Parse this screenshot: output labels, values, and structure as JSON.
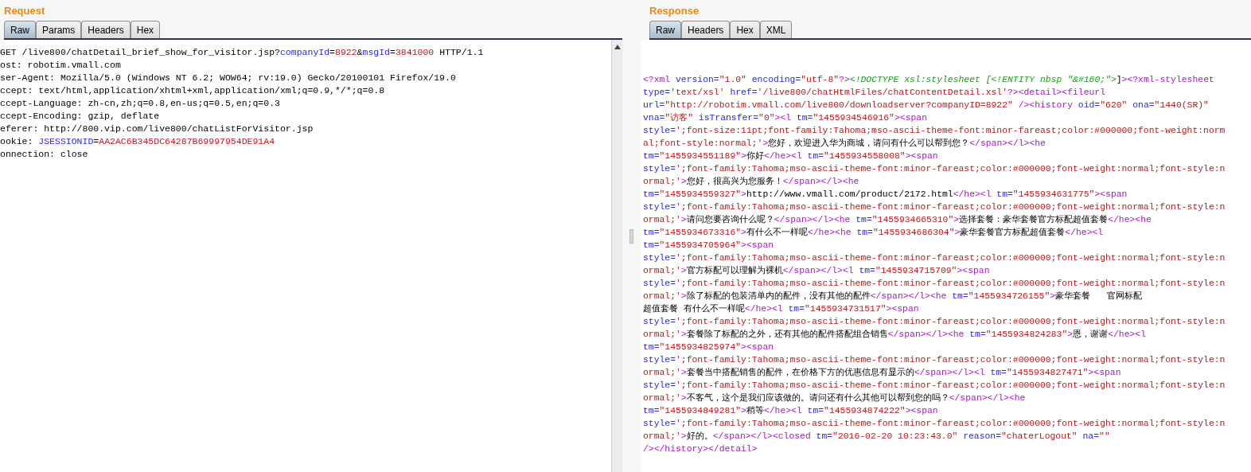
{
  "request": {
    "title": "Request",
    "tabs": [
      {
        "label": "Raw",
        "selected": true
      },
      {
        "label": "Params",
        "selected": false
      },
      {
        "label": "Headers",
        "selected": false
      },
      {
        "label": "Hex",
        "selected": false
      }
    ],
    "lines": [
      [
        {
          "kind": "plain",
          "text": "GET /live800/chatDetail_brief_show_for_visitor.jsp?"
        },
        {
          "kind": "attr",
          "text": "companyId"
        },
        {
          "kind": "plain",
          "text": "="
        },
        {
          "kind": "val",
          "text": "8922"
        },
        {
          "kind": "plain",
          "text": "&"
        },
        {
          "kind": "attr",
          "text": "msgId"
        },
        {
          "kind": "plain",
          "text": "="
        },
        {
          "kind": "val",
          "text": "3841000"
        },
        {
          "kind": "plain",
          "text": " HTTP/1.1"
        }
      ],
      [
        {
          "kind": "plain",
          "text": "ost: robotim.vmall.com"
        }
      ],
      [
        {
          "kind": "plain",
          "text": "ser-Agent: Mozilla/5.0 (Windows NT 6.2; WOW64; rv:19.0) Gecko/20100101 Firefox/19.0"
        }
      ],
      [
        {
          "kind": "plain",
          "text": "ccept: text/html,application/xhtml+xml,application/xml;q=0.9,*/*;q=0.8"
        }
      ],
      [
        {
          "kind": "plain",
          "text": "ccept-Language: zh-cn,zh;q=0.8,en-us;q=0.5,en;q=0.3"
        }
      ],
      [
        {
          "kind": "plain",
          "text": "ccept-Encoding: gzip, deflate"
        }
      ],
      [
        {
          "kind": "plain",
          "text": "eferer: http://800.vip.com/live800/chatListForVisitor.jsp"
        }
      ],
      [
        {
          "kind": "plain",
          "text": "ookie: "
        },
        {
          "kind": "attr",
          "text": "JSESSIONID"
        },
        {
          "kind": "plain",
          "text": "="
        },
        {
          "kind": "val",
          "text": "AA2AC6B345DC64287B69997954DE91A4"
        }
      ],
      [
        {
          "kind": "plain",
          "text": "onnection: close"
        }
      ]
    ]
  },
  "response": {
    "title": "Response",
    "tabs": [
      {
        "label": "Raw",
        "selected": true
      },
      {
        "label": "Headers",
        "selected": false
      },
      {
        "label": "Hex",
        "selected": false
      },
      {
        "label": "XML",
        "selected": false
      }
    ],
    "lines": [
      [
        {
          "kind": "tag",
          "text": "<?xml"
        },
        {
          "kind": "attr",
          "text": " version="
        },
        {
          "kind": "val",
          "text": "\"1.0\""
        },
        {
          "kind": "attr",
          "text": " encoding="
        },
        {
          "kind": "val",
          "text": "\"utf-8\""
        },
        {
          "kind": "tag",
          "text": "?>"
        },
        {
          "kind": "dtd",
          "text": "<!DOCTYPE xsl:stylesheet [<!ENTITY nbsp \"&#160;\">"
        },
        {
          "kind": "plain",
          "text": "]"
        },
        {
          "kind": "tag",
          "text": "><?xml-stylesheet"
        }
      ],
      [
        {
          "kind": "attr",
          "text": "type="
        },
        {
          "kind": "val",
          "text": "'text/xsl'"
        },
        {
          "kind": "attr",
          "text": " href="
        },
        {
          "kind": "val",
          "text": "'/live800/chatHtmlFiles/chatContentDetail.xsl'"
        },
        {
          "kind": "tag",
          "text": "?><detail><fileurl"
        }
      ],
      [
        {
          "kind": "attr",
          "text": "url="
        },
        {
          "kind": "val",
          "text": "\"http://robotim.vmall.com/live800/downloadserver?companyID=8922\""
        },
        {
          "kind": "tag",
          "text": " /><history"
        },
        {
          "kind": "attr",
          "text": " oid="
        },
        {
          "kind": "val",
          "text": "\"620\""
        },
        {
          "kind": "attr",
          "text": " ona="
        },
        {
          "kind": "val",
          "text": "\"1440(SR)\""
        }
      ],
      [
        {
          "kind": "attr",
          "text": "vna="
        },
        {
          "kind": "val",
          "text": "\"访客\""
        },
        {
          "kind": "attr",
          "text": " isTransfer="
        },
        {
          "kind": "val",
          "text": "\"0\""
        },
        {
          "kind": "tag",
          "text": "><l"
        },
        {
          "kind": "attr",
          "text": " tm="
        },
        {
          "kind": "val",
          "text": "\"1455934546916\""
        },
        {
          "kind": "tag",
          "text": "><span"
        }
      ],
      [
        {
          "kind": "attr",
          "text": "style="
        },
        {
          "kind": "val",
          "text": "';font-size:11pt;font-family:Tahoma;mso-ascii-theme-font:minor-fareast;color:#000000;font-weight:norm"
        }
      ],
      [
        {
          "kind": "val",
          "text": "al;font-style:normal;'"
        },
        {
          "kind": "tag",
          "text": ">"
        },
        {
          "kind": "text",
          "text": "您好，欢迎进入华为商城，请问有什么可以帮到您？"
        },
        {
          "kind": "tag",
          "text": "</span></l><he"
        }
      ],
      [
        {
          "kind": "attr",
          "text": "tm="
        },
        {
          "kind": "val",
          "text": "\"1455934551189\""
        },
        {
          "kind": "tag",
          "text": ">"
        },
        {
          "kind": "text",
          "text": "你好"
        },
        {
          "kind": "tag",
          "text": "</he><l"
        },
        {
          "kind": "attr",
          "text": " tm="
        },
        {
          "kind": "val",
          "text": "\"1455934558008\""
        },
        {
          "kind": "tag",
          "text": "><span"
        }
      ],
      [
        {
          "kind": "attr",
          "text": "style="
        },
        {
          "kind": "val",
          "text": "';font-family:Tahoma;mso-ascii-theme-font:minor-fareast;color:#000000;font-weight:normal;font-style:n"
        }
      ],
      [
        {
          "kind": "val",
          "text": "ormal;'"
        },
        {
          "kind": "tag",
          "text": ">"
        },
        {
          "kind": "text",
          "text": "您好，很高兴为您服务！"
        },
        {
          "kind": "tag",
          "text": "</span></l><he"
        }
      ],
      [
        {
          "kind": "attr",
          "text": "tm="
        },
        {
          "kind": "val",
          "text": "\"1455934559327\""
        },
        {
          "kind": "tag",
          "text": ">"
        },
        {
          "kind": "text",
          "text": "http://www.vmall.com/product/2172.html"
        },
        {
          "kind": "tag",
          "text": "</he><l"
        },
        {
          "kind": "attr",
          "text": " tm="
        },
        {
          "kind": "val",
          "text": "\"1455934631775\""
        },
        {
          "kind": "tag",
          "text": "><span"
        }
      ],
      [
        {
          "kind": "attr",
          "text": "style="
        },
        {
          "kind": "val",
          "text": "';font-family:Tahoma;mso-ascii-theme-font:minor-fareast;color:#000000;font-weight:normal;font-style:n"
        }
      ],
      [
        {
          "kind": "val",
          "text": "ormal;'"
        },
        {
          "kind": "tag",
          "text": ">"
        },
        {
          "kind": "text",
          "text": "请问您要咨询什么呢？"
        },
        {
          "kind": "tag",
          "text": "</span></l><he"
        },
        {
          "kind": "attr",
          "text": " tm="
        },
        {
          "kind": "val",
          "text": "\"1455934665310\""
        },
        {
          "kind": "tag",
          "text": ">"
        },
        {
          "kind": "text",
          "text": "选择套餐：豪华套餐官方标配超值套餐"
        },
        {
          "kind": "tag",
          "text": "</he><he"
        }
      ],
      [
        {
          "kind": "attr",
          "text": "tm="
        },
        {
          "kind": "val",
          "text": "\"1455934673316\""
        },
        {
          "kind": "tag",
          "text": ">"
        },
        {
          "kind": "text",
          "text": "有什么不一样呢"
        },
        {
          "kind": "tag",
          "text": "</he><he"
        },
        {
          "kind": "attr",
          "text": " tm="
        },
        {
          "kind": "val",
          "text": "\"1455934686304\""
        },
        {
          "kind": "tag",
          "text": ">"
        },
        {
          "kind": "text",
          "text": "豪华套餐官方标配超值套餐"
        },
        {
          "kind": "tag",
          "text": "</he><l"
        }
      ],
      [
        {
          "kind": "attr",
          "text": "tm="
        },
        {
          "kind": "val",
          "text": "\"1455934705964\""
        },
        {
          "kind": "tag",
          "text": "><span"
        }
      ],
      [
        {
          "kind": "attr",
          "text": "style="
        },
        {
          "kind": "val",
          "text": "';font-family:Tahoma;mso-ascii-theme-font:minor-fareast;color:#000000;font-weight:normal;font-style:n"
        }
      ],
      [
        {
          "kind": "val",
          "text": "ormal;'"
        },
        {
          "kind": "tag",
          "text": ">"
        },
        {
          "kind": "text",
          "text": "官方标配可以理解为裸机"
        },
        {
          "kind": "tag",
          "text": "</span></l><l"
        },
        {
          "kind": "attr",
          "text": " tm="
        },
        {
          "kind": "val",
          "text": "\"1455934715709\""
        },
        {
          "kind": "tag",
          "text": "><span"
        }
      ],
      [
        {
          "kind": "attr",
          "text": "style="
        },
        {
          "kind": "val",
          "text": "';font-family:Tahoma;mso-ascii-theme-font:minor-fareast;color:#000000;font-weight:normal;font-style:n"
        }
      ],
      [
        {
          "kind": "val",
          "text": "ormal;'"
        },
        {
          "kind": "tag",
          "text": ">"
        },
        {
          "kind": "text",
          "text": "除了标配的包装清单内的配件，没有其他的配件"
        },
        {
          "kind": "tag",
          "text": "</span></l><he"
        },
        {
          "kind": "attr",
          "text": " tm="
        },
        {
          "kind": "val",
          "text": "\"1455934726155\""
        },
        {
          "kind": "tag",
          "text": ">"
        },
        {
          "kind": "text",
          "text": "豪华套餐   官网标配"
        }
      ],
      [
        {
          "kind": "text",
          "text": "超值套餐 有什么不一样呢"
        },
        {
          "kind": "tag",
          "text": "</he><l"
        },
        {
          "kind": "attr",
          "text": " tm="
        },
        {
          "kind": "val",
          "text": "\"1455934731517\""
        },
        {
          "kind": "tag",
          "text": "><span"
        }
      ],
      [
        {
          "kind": "attr",
          "text": "style="
        },
        {
          "kind": "val",
          "text": "';font-family:Tahoma;mso-ascii-theme-font:minor-fareast;color:#000000;font-weight:normal;font-style:n"
        }
      ],
      [
        {
          "kind": "val",
          "text": "ormal;'"
        },
        {
          "kind": "tag",
          "text": ">"
        },
        {
          "kind": "text",
          "text": "套餐除了标配的之外，还有其他的配件搭配组合销售"
        },
        {
          "kind": "tag",
          "text": "</span></l><he"
        },
        {
          "kind": "attr",
          "text": " tm="
        },
        {
          "kind": "val",
          "text": "\"1455934824283\""
        },
        {
          "kind": "tag",
          "text": ">"
        },
        {
          "kind": "text",
          "text": "恩，谢谢"
        },
        {
          "kind": "tag",
          "text": "</he><l"
        }
      ],
      [
        {
          "kind": "attr",
          "text": "tm="
        },
        {
          "kind": "val",
          "text": "\"1455934825974\""
        },
        {
          "kind": "tag",
          "text": "><span"
        }
      ],
      [
        {
          "kind": "attr",
          "text": "style="
        },
        {
          "kind": "val",
          "text": "';font-family:Tahoma;mso-ascii-theme-font:minor-fareast;color:#000000;font-weight:normal;font-style:n"
        }
      ],
      [
        {
          "kind": "val",
          "text": "ormal;'"
        },
        {
          "kind": "tag",
          "text": ">"
        },
        {
          "kind": "text",
          "text": "套餐当中搭配销售的配件，在价格下方的优惠信息有显示的"
        },
        {
          "kind": "tag",
          "text": "</span></l><l"
        },
        {
          "kind": "attr",
          "text": " tm="
        },
        {
          "kind": "val",
          "text": "\"1455934827471\""
        },
        {
          "kind": "tag",
          "text": "><span"
        }
      ],
      [
        {
          "kind": "attr",
          "text": "style="
        },
        {
          "kind": "val",
          "text": "';font-family:Tahoma;mso-ascii-theme-font:minor-fareast;color:#000000;font-weight:normal;font-style:n"
        }
      ],
      [
        {
          "kind": "val",
          "text": "ormal;'"
        },
        {
          "kind": "tag",
          "text": ">"
        },
        {
          "kind": "text",
          "text": "不客气，这个是我们应该做的。请问还有什么其他可以帮到您的吗？"
        },
        {
          "kind": "tag",
          "text": "</span></l><he"
        }
      ],
      [
        {
          "kind": "attr",
          "text": "tm="
        },
        {
          "kind": "val",
          "text": "\"1455934849281\""
        },
        {
          "kind": "tag",
          "text": ">"
        },
        {
          "kind": "text",
          "text": "稍等"
        },
        {
          "kind": "tag",
          "text": "</he><l"
        },
        {
          "kind": "attr",
          "text": " tm="
        },
        {
          "kind": "val",
          "text": "\"1455934874222\""
        },
        {
          "kind": "tag",
          "text": "><span"
        }
      ],
      [
        {
          "kind": "attr",
          "text": "style="
        },
        {
          "kind": "val",
          "text": "';font-family:Tahoma;mso-ascii-theme-font:minor-fareast;color:#000000;font-weight:normal;font-style:n"
        }
      ],
      [
        {
          "kind": "val",
          "text": "ormal;'"
        },
        {
          "kind": "tag",
          "text": ">"
        },
        {
          "kind": "text",
          "text": "好的。"
        },
        {
          "kind": "tag",
          "text": "</span></l><closed"
        },
        {
          "kind": "attr",
          "text": " tm="
        },
        {
          "kind": "val",
          "text": "\"2016-02-20 10:23:43.0\""
        },
        {
          "kind": "attr",
          "text": " reason="
        },
        {
          "kind": "val",
          "text": "\"chaterLogout\""
        },
        {
          "kind": "attr",
          "text": " na="
        },
        {
          "kind": "val",
          "text": "\"\""
        }
      ],
      [
        {
          "kind": "tag",
          "text": "/></history></detail>"
        }
      ]
    ]
  }
}
